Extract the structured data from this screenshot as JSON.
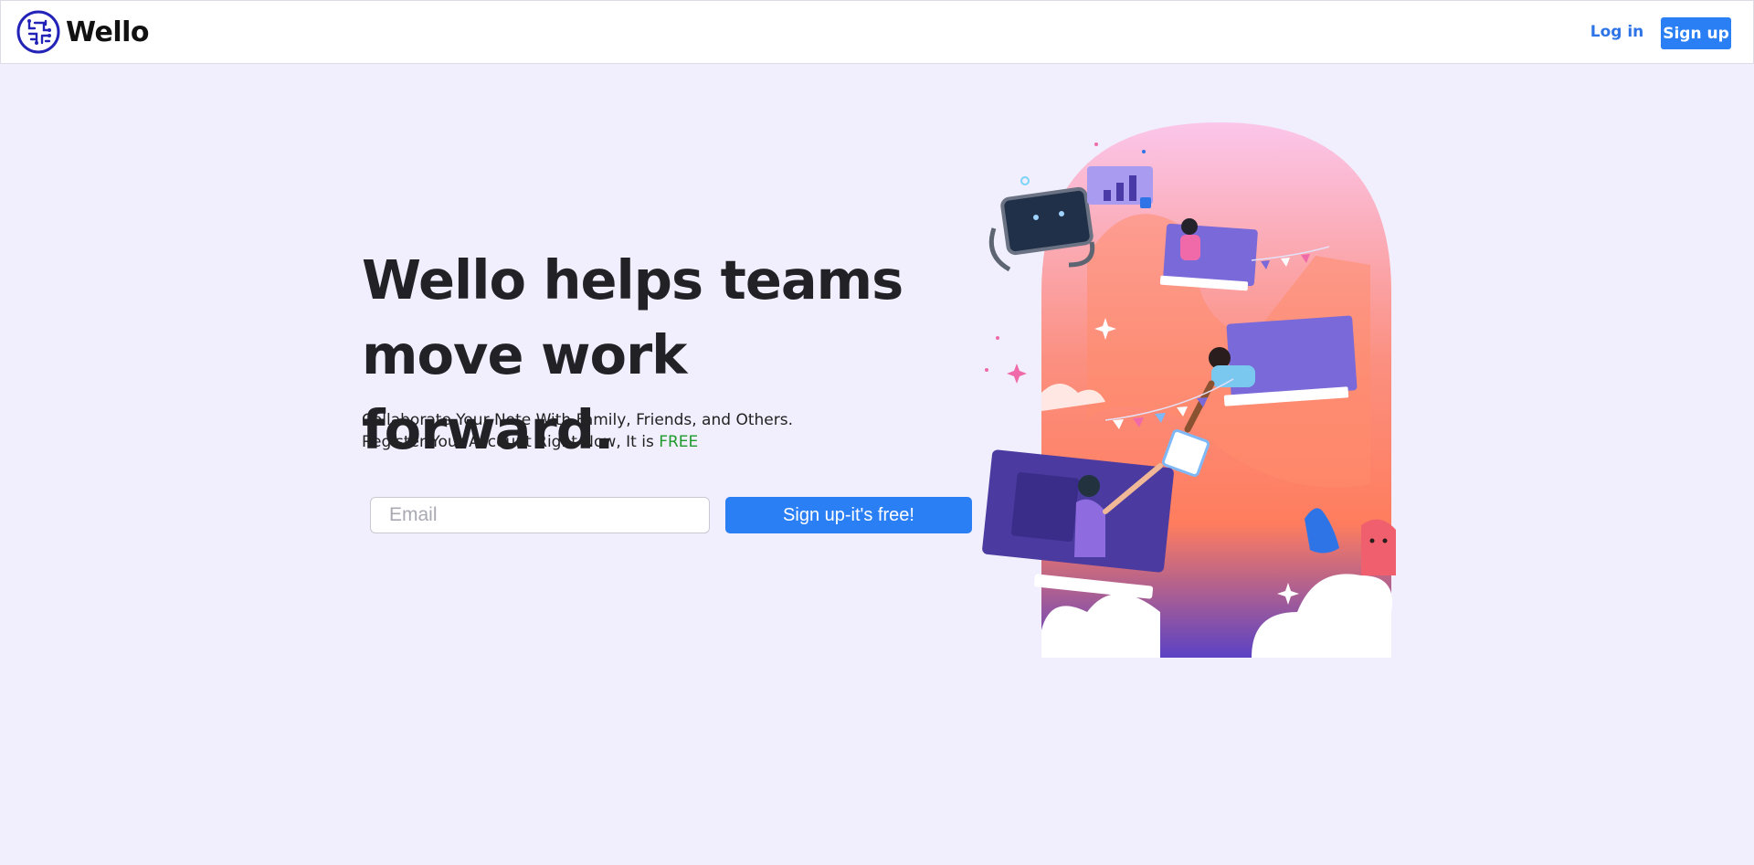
{
  "nav": {
    "brand_name": "Wello",
    "login_label": "Log in",
    "signup_label": "Sign up",
    "logo_icon": "circuit-brain-icon"
  },
  "hero": {
    "headline_line1": "Wello helps teams",
    "headline_line2": "move work forward.",
    "subtext_line1": "Collaborate Your Note With Family, Friends, and Others.",
    "subtext_line2_prefix": "Register Your Account Right Now, It is ",
    "subtext_free": "FREE",
    "email_placeholder": "Email",
    "email_value": "",
    "cta_label": "Sign up-it's free!"
  },
  "colors": {
    "page_background": "#f1effd",
    "accent": "#2b7ff4",
    "free_text": "#1f9a2c"
  }
}
